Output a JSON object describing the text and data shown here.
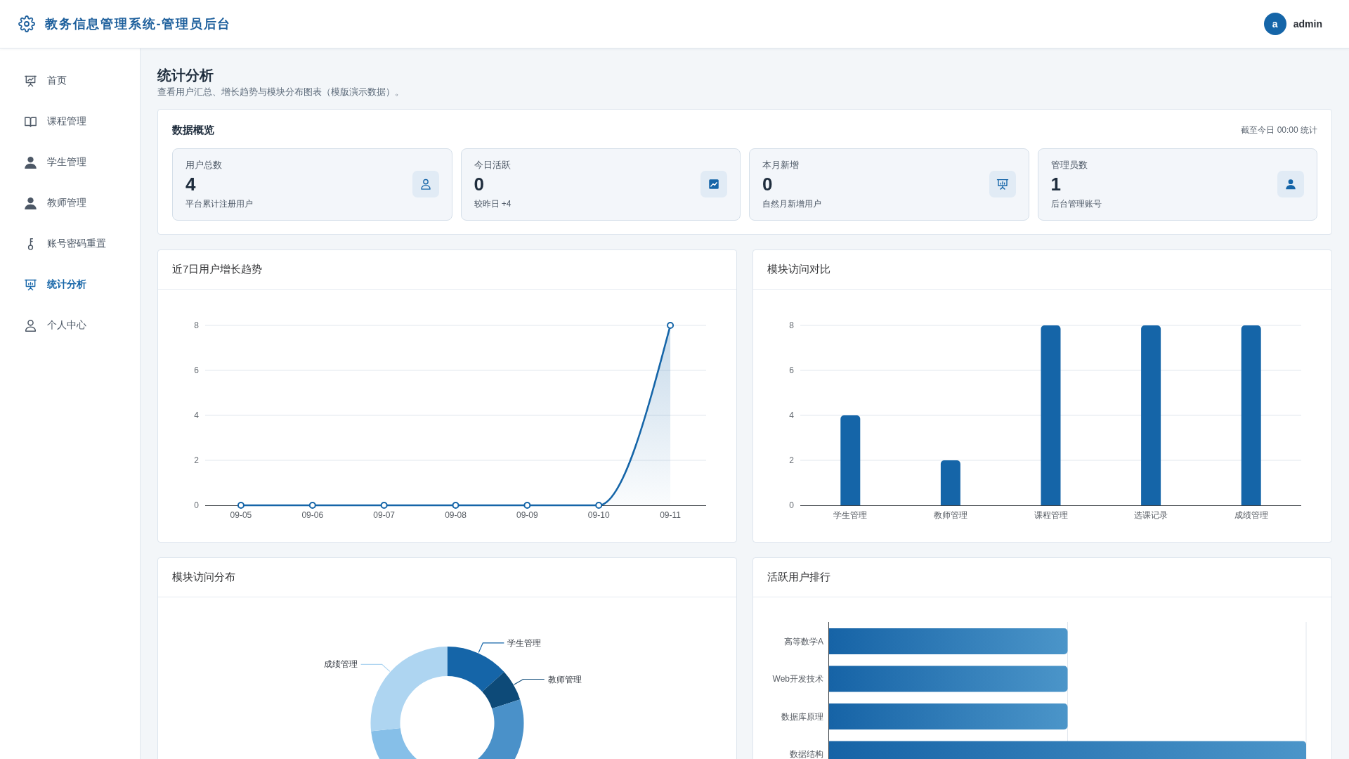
{
  "header": {
    "title": "教务信息管理系统-管理员后台",
    "user": {
      "avatar": "a",
      "name": "admin"
    }
  },
  "sidebar": {
    "items": [
      {
        "label": "首页",
        "selected": false
      },
      {
        "label": "课程管理",
        "selected": false
      },
      {
        "label": "学生管理",
        "selected": false
      },
      {
        "label": "教师管理",
        "selected": false
      },
      {
        "label": "账号密码重置",
        "selected": false
      },
      {
        "label": "统计分析",
        "selected": true
      },
      {
        "label": "个人中心",
        "selected": false
      }
    ]
  },
  "page": {
    "title": "统计分析",
    "subtitle": "查看用户汇总、增长趋势与模块分布图表（模版演示数据）。"
  },
  "overview": {
    "title": "数据概览",
    "note": "截至今日 00:00 统计",
    "stats": [
      {
        "label": "用户总数",
        "value": "4",
        "note": "平台累计注册用户"
      },
      {
        "label": "今日活跃",
        "value": "0",
        "note": "较昨日 +4"
      },
      {
        "label": "本月新增",
        "value": "0",
        "note": "自然月新增用户"
      },
      {
        "label": "管理员数",
        "value": "1",
        "note": "后台管理账号"
      }
    ]
  },
  "growth_chart": {
    "title": "近7日用户增长趋势",
    "chart_data": {
      "type": "area",
      "categories": [
        "09-05",
        "09-06",
        "09-07",
        "09-08",
        "09-09",
        "09-10",
        "09-11"
      ],
      "series": [
        {
          "color": "#1565a8",
          "values": [
            0,
            0,
            0,
            0,
            0,
            0,
            8
          ]
        }
      ],
      "ylim": [
        0,
        8
      ],
      "yticks": [
        0,
        2,
        4,
        6,
        8
      ],
      "grid": true
    }
  },
  "module_compare": {
    "title": "模块访问对比",
    "chart_data": {
      "type": "bar",
      "categories": [
        "学生管理",
        "教师管理",
        "课程管理",
        "选课记录",
        "成绩管理"
      ],
      "series": [
        {
          "color": "#1565a8",
          "values": [
            4,
            2,
            8,
            8,
            8
          ]
        }
      ],
      "ylim": [
        0,
        8
      ],
      "yticks": [
        0,
        2,
        4,
        6,
        8
      ],
      "grid": true
    }
  },
  "module_distribution": {
    "title": "模块访问分布",
    "labels": [
      "学生管理",
      "教师管理",
      "成绩管理"
    ]
  },
  "active_ranking": {
    "title": "活跃用户排行",
    "rows": [
      "高等数学A",
      "Web开发技术",
      "数据库原理",
      "数据结构"
    ]
  }
}
